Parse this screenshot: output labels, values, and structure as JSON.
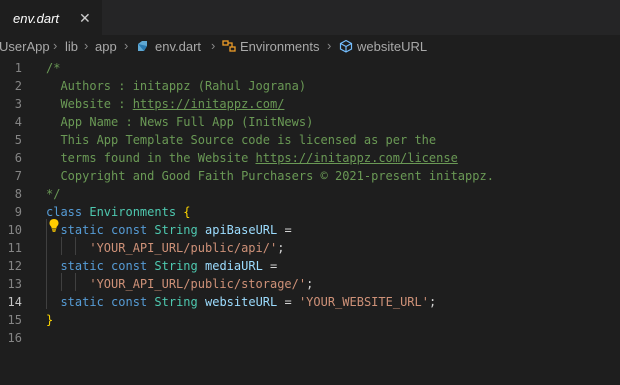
{
  "tab": {
    "label": "env.dart",
    "close": "✕"
  },
  "breadcrumb": {
    "items": [
      "UserApp",
      "lib",
      "app",
      "env.dart",
      "Environments",
      "websiteURL"
    ]
  },
  "editor": {
    "active_line": 14,
    "lines": [
      {
        "n": "1",
        "tokens": [
          [
            "cm",
            "/*"
          ]
        ]
      },
      {
        "n": "2",
        "tokens": [
          [
            "cm",
            "  Authors : initappz (Rahul Jograna)"
          ]
        ]
      },
      {
        "n": "3",
        "tokens": [
          [
            "cm",
            "  Website : "
          ],
          [
            "lk",
            "https://initappz.com/"
          ]
        ]
      },
      {
        "n": "4",
        "tokens": [
          [
            "cm",
            "  App Name : News Full App (InitNews)"
          ]
        ]
      },
      {
        "n": "5",
        "tokens": [
          [
            "cm",
            "  This App Template Source code is licensed as per the"
          ]
        ]
      },
      {
        "n": "6",
        "tokens": [
          [
            "cm",
            "  terms found in the Website "
          ],
          [
            "lk",
            "https://initappz.com/license"
          ]
        ]
      },
      {
        "n": "7",
        "tokens": [
          [
            "cm",
            "  Copyright and Good Faith Purchasers © 2021-present initappz."
          ]
        ]
      },
      {
        "n": "8",
        "tokens": [
          [
            "cm",
            "*/"
          ]
        ]
      },
      {
        "n": "9",
        "tokens": [
          [
            "kw",
            "class"
          ],
          [
            "pn",
            " "
          ],
          [
            "ty",
            "Environments"
          ],
          [
            "pn",
            " "
          ],
          [
            "br",
            "{"
          ]
        ]
      },
      {
        "n": "10",
        "tokens": [
          [
            "pn",
            "  "
          ],
          [
            "kw",
            "static"
          ],
          [
            "pn",
            " "
          ],
          [
            "kw",
            "const"
          ],
          [
            "pn",
            " "
          ],
          [
            "ty",
            "String"
          ],
          [
            "pn",
            " "
          ],
          [
            "vr",
            "apiBaseURL"
          ],
          [
            "pn",
            " ="
          ]
        ]
      },
      {
        "n": "11",
        "tokens": [
          [
            "pn",
            "      "
          ],
          [
            "st",
            "'YOUR_API_URL/public/api/'"
          ],
          [
            "pn",
            ";"
          ]
        ]
      },
      {
        "n": "12",
        "tokens": [
          [
            "pn",
            "  "
          ],
          [
            "kw",
            "static"
          ],
          [
            "pn",
            " "
          ],
          [
            "kw",
            "const"
          ],
          [
            "pn",
            " "
          ],
          [
            "ty",
            "String"
          ],
          [
            "pn",
            " "
          ],
          [
            "vr",
            "mediaURL"
          ],
          [
            "pn",
            " ="
          ]
        ]
      },
      {
        "n": "13",
        "tokens": [
          [
            "pn",
            "      "
          ],
          [
            "st",
            "'YOUR_API_URL/public/storage/'"
          ],
          [
            "pn",
            ";"
          ]
        ]
      },
      {
        "n": "14",
        "tokens": [
          [
            "pn",
            "  "
          ],
          [
            "kw",
            "static"
          ],
          [
            "pn",
            " "
          ],
          [
            "kw",
            "const"
          ],
          [
            "pn",
            " "
          ],
          [
            "ty",
            "String"
          ],
          [
            "pn",
            " "
          ],
          [
            "vr",
            "websiteURL"
          ],
          [
            "pn",
            " = "
          ],
          [
            "st",
            "'YOUR_WEBSITE_URL'"
          ],
          [
            "pn",
            ";"
          ]
        ]
      },
      {
        "n": "15",
        "tokens": [
          [
            "br",
            "}"
          ]
        ]
      },
      {
        "n": "16",
        "tokens": []
      }
    ]
  },
  "colors": {
    "background": "#1e1e1e",
    "comment": "#6a9955",
    "keyword": "#569cd6",
    "type": "#4ec9b0",
    "variable": "#9cdcfe",
    "string": "#ce9178",
    "bracket": "#ffd700"
  },
  "icons": {
    "tab_close": "close-icon",
    "dart_file": "dart-icon",
    "class_symbol": "class-icon",
    "field_symbol": "field-icon",
    "quick_fix": "lightbulb-icon"
  }
}
